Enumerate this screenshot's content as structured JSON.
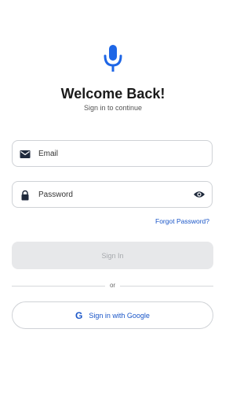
{
  "header": {
    "logo_icon": "microphone-icon",
    "title": "Welcome Back!",
    "subtitle": "Sign in to continue"
  },
  "form": {
    "email_placeholder": "Email",
    "email_icon": "envelope-icon",
    "password_placeholder": "Password",
    "password_icon": "lock-icon",
    "visibility_icon": "eye-icon",
    "forgot_password": "Forgot Password?",
    "sign_in": "Sign In"
  },
  "divider_text": "or",
  "google": {
    "icon": "google-g-icon",
    "icon_text": "G",
    "label": "Sign in with Google"
  },
  "colors": {
    "accent": "#1a56c8",
    "mic": "#1e66e6",
    "disabled_button": "#e7e8ea"
  }
}
